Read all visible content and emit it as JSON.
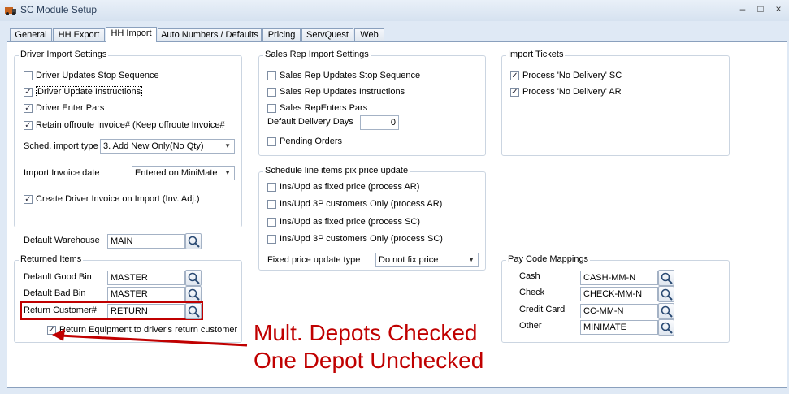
{
  "window": {
    "title": "SC Module Setup",
    "minimize": "–",
    "maximize": "□",
    "close": "×"
  },
  "tabs": [
    {
      "label": "General",
      "active": false
    },
    {
      "label": "HH Export",
      "active": false
    },
    {
      "label": "HH Import",
      "active": true
    },
    {
      "label": "Auto Numbers / Defaults",
      "active": false
    },
    {
      "label": "Pricing",
      "active": false
    },
    {
      "label": "ServQuest",
      "active": false
    },
    {
      "label": "Web",
      "active": false
    }
  ],
  "driver_import": {
    "title": "Driver Import Settings",
    "checkboxes": [
      {
        "label": "Driver Updates Stop Sequence",
        "checked": false
      },
      {
        "label": "Driver Update Instructions",
        "checked": true
      },
      {
        "label": "Driver Enter Pars",
        "checked": true
      },
      {
        "label": "Retain offroute Invoice# (Keep offroute Invoice#)",
        "checked": true
      }
    ],
    "sched_label": "Sched. import type",
    "sched_value": "3. Add New Only(No Qty)",
    "invoice_date_label": "Import Invoice date",
    "invoice_date_value": "Entered on MiniMate",
    "create_invoice": {
      "label": "Create Driver Invoice on Import (Inv. Adj.)",
      "checked": true
    }
  },
  "warehouse": {
    "label": "Default Warehouse",
    "value": "MAIN"
  },
  "returned_items": {
    "title": "Returned Items",
    "good_bin_label": "Default Good Bin",
    "good_bin_value": "MASTER",
    "bad_bin_label": "Default Bad Bin",
    "bad_bin_value": "MASTER",
    "return_customer_label": "Return Customer#",
    "return_customer_value": "RETURN",
    "return_equipment": {
      "label": "Return Equipment to driver's return customer",
      "checked": true
    }
  },
  "sales_rep": {
    "title": "Sales Rep Import Settings",
    "checkboxes": [
      {
        "label": "Sales Rep Updates Stop Sequence",
        "checked": false
      },
      {
        "label": "Sales Rep Updates Instructions",
        "checked": false
      },
      {
        "label": "Sales RepEnters Pars",
        "checked": false
      }
    ],
    "delivery_days_label": "Default Delivery Days",
    "delivery_days_value": "0",
    "pending_orders": {
      "label": "Pending Orders",
      "checked": false
    }
  },
  "schedule_pix": {
    "title": "Schedule line items pix price update",
    "checkboxes": [
      {
        "label": "Ins/Upd as fixed price (process AR)",
        "checked": false
      },
      {
        "label": "Ins/Upd 3P customers Only (process AR)",
        "checked": false
      },
      {
        "label": "Ins/Upd as fixed price (process SC)",
        "checked": false
      },
      {
        "label": "Ins/Upd 3P customers Only (process SC)",
        "checked": false
      }
    ],
    "fixed_label": "Fixed price update type",
    "fixed_value": "Do not fix price"
  },
  "import_tickets": {
    "title": "Import Tickets",
    "checkboxes": [
      {
        "label": "Process 'No Delivery' SC",
        "checked": true
      },
      {
        "label": "Process 'No Delivery' AR",
        "checked": true
      }
    ]
  },
  "pay_code": {
    "title": "Pay Code Mappings",
    "rows": [
      {
        "label": "Cash",
        "value": "CASH-MM-N"
      },
      {
        "label": "Check",
        "value": "CHECK-MM-N"
      },
      {
        "label": "Credit Card",
        "value": "CC-MM-N"
      },
      {
        "label": "Other",
        "value": "MINIMATE"
      }
    ]
  },
  "annotation": {
    "line1": "Mult. Depots Checked",
    "line2": "One Depot Unchecked"
  },
  "colors": {
    "accent_red": "#c00000",
    "window_bg": "#dfe9f5",
    "border": "#8aa0bd"
  }
}
